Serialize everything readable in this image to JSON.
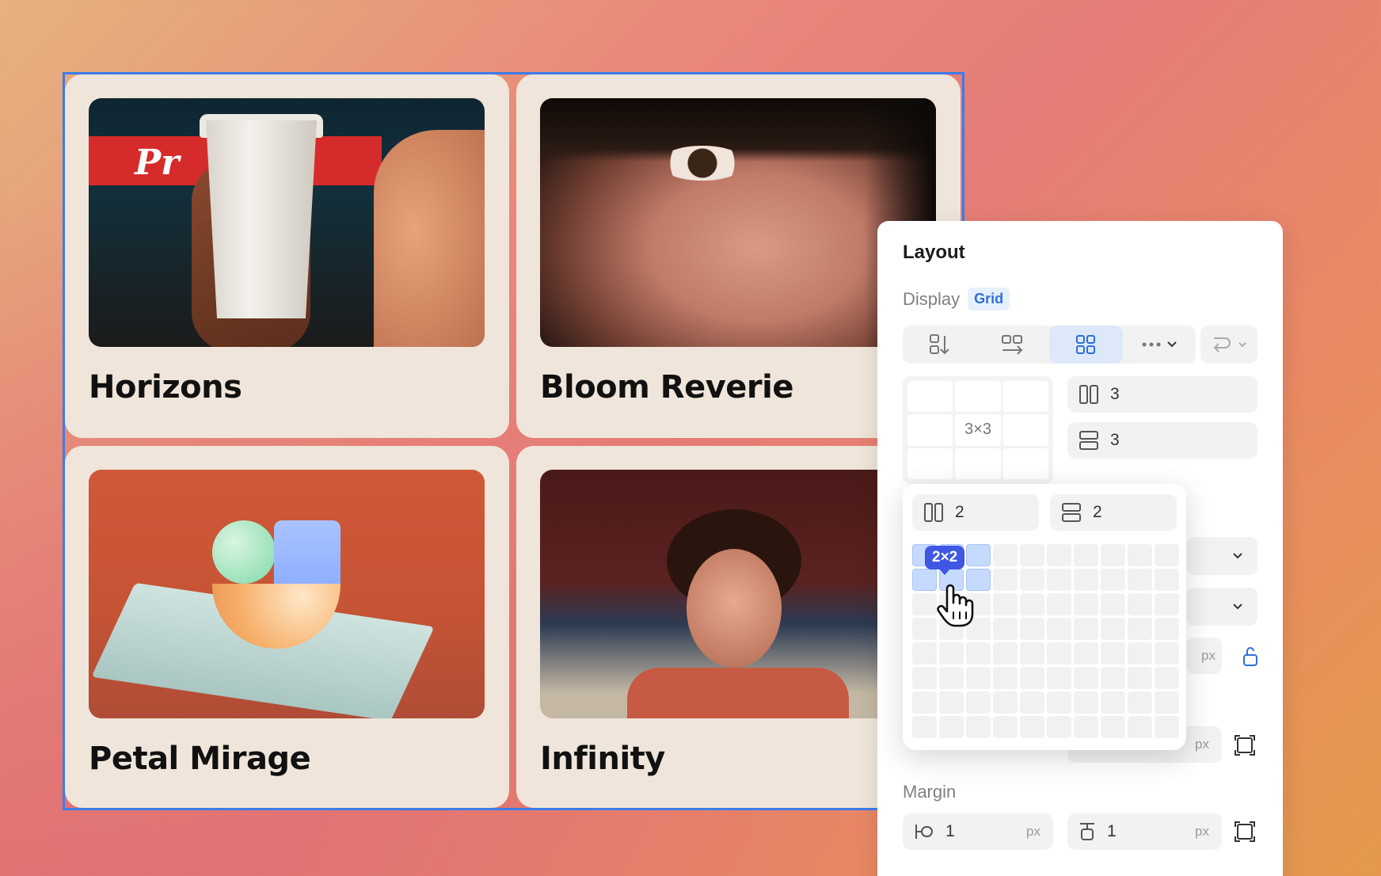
{
  "cards": [
    {
      "title": "Horizons",
      "sign_text": "Pr"
    },
    {
      "title": "Bloom Reverie"
    },
    {
      "title": "Petal Mirage"
    },
    {
      "title": "Infinity"
    }
  ],
  "panel": {
    "heading": "Layout",
    "display_label": "Display",
    "display_badge": "Grid",
    "mini_grid_label": "3×3",
    "columns_value": "3",
    "rows_value": "3",
    "unit": "px",
    "margin_label": "Margin",
    "margin_left_value": "1",
    "margin_top_value": "1"
  },
  "popover": {
    "columns_value": "2",
    "rows_value": "2",
    "tooltip": "2×2",
    "selected_columns": 3,
    "selected_rows": 2,
    "total_columns": 10,
    "total_rows": 8
  },
  "colors": {
    "accent": "#2f6fd8",
    "selection_frame": "#3d7ce8",
    "tooltip_bg": "#3f57e3",
    "card_bg": "#efe5da"
  }
}
